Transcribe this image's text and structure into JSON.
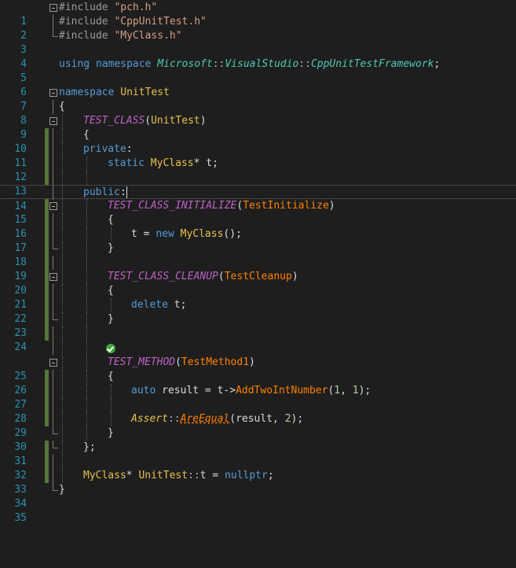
{
  "editor": {
    "language": "C++",
    "colors": {
      "background": "#1e1e1e",
      "line_number": "#2b91af",
      "keyword": "#569cd6",
      "string": "#d69d85",
      "macro": "#bd63c5",
      "class": "#e7c14d",
      "function": "#ff8000",
      "change_bar": "#56763b"
    },
    "line_numbers": [
      "1",
      "2",
      "3",
      "4",
      "5",
      "6",
      "7",
      "8",
      "9",
      "10",
      "11",
      "12",
      "13",
      "14",
      "15",
      "16",
      "17",
      "18",
      "19",
      "20",
      "21",
      "22",
      "23",
      "24",
      "25",
      "26",
      "27",
      "28",
      "29",
      "30",
      "31",
      "32",
      "33",
      "34",
      "35"
    ],
    "code": {
      "l1_kw": "#include",
      "l1_str": "\"pch.h\"",
      "l2_kw": "#include",
      "l2_str": "\"CppUnitTest.h\"",
      "l3_kw": "#include",
      "l3_str": "\"MyClass.h\"",
      "l5_using": "using",
      "l5_namespace": "namespace",
      "l5_ns1": "Microsoft",
      "l5_sep": "::",
      "l5_ns2": "VisualStudio",
      "l5_ns3": "CppUnitTestFramework",
      "l5_semi": ";",
      "l7_namespace": "namespace",
      "l7_name": "UnitTest",
      "l8_brace": "{",
      "l9_macro": "TEST_CLASS",
      "l9_open": "(",
      "l9_arg": "UnitTest",
      "l9_close": ")",
      "l10_brace": "{",
      "l11_private": "private",
      "l11_colon": ":",
      "l12_static": "static",
      "l12_type": "MyClass",
      "l12_rest": "* t;",
      "l14_public": "public",
      "l14_colon": ":",
      "l15_macro": "TEST_CLASS_INITIALIZE",
      "l15_open": "(",
      "l15_arg": "TestInitialize",
      "l15_close": ")",
      "l16_brace": "{",
      "l17_lhs": "t = ",
      "l17_new": "new",
      "l17_type": "MyClass",
      "l17_rest": "();",
      "l18_brace": "}",
      "l20_macro": "TEST_CLASS_CLEANUP",
      "l20_open": "(",
      "l20_arg": "TestCleanup",
      "l20_close": ")",
      "l21_brace": "{",
      "l22_delete": "delete",
      "l22_rest": " t;",
      "l23_brace": "}",
      "l25_macro": "TEST_METHOD",
      "l25_open": "(",
      "l25_arg": "TestMethod1",
      "l25_close": ")",
      "l26_brace": "{",
      "l27_auto": "auto",
      "l27_mid": " result = t->",
      "l27_fn": "AddTwoIntNumber",
      "l27_open": "(",
      "l27_n1": "1",
      "l27_comma": ", ",
      "l27_n2": "1",
      "l27_end": ");",
      "l29_assert": "Assert",
      "l29_sep": "::",
      "l29_fn": "AreEqual",
      "l29_open": "(",
      "l29_args": "result, ",
      "l29_n": "2",
      "l29_end": ");",
      "l30_brace": "}",
      "l31_brace": "};",
      "l33_type": "MyClass",
      "l33_star": "* ",
      "l33_ns": "UnitTest",
      "l33_sep": "::",
      "l33_mid": "t = ",
      "l33_null": "nullptr",
      "l33_semi": ";",
      "l34_brace": "}"
    },
    "codelens": {
      "icon": "test-passed-check-icon"
    }
  }
}
